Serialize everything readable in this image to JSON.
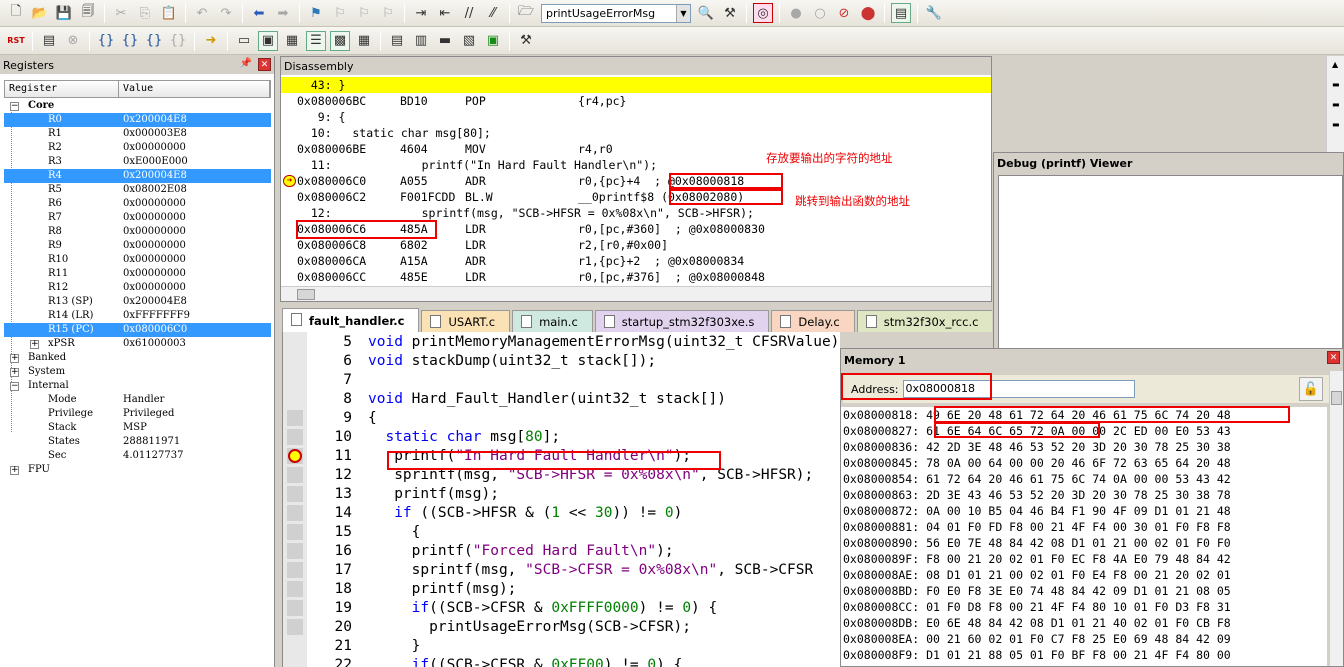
{
  "toolbar": {
    "function_combo": "printUsageErrorMsg"
  },
  "registers": {
    "title": "Registers",
    "col_register": "Register",
    "col_value": "Value",
    "core_label": "Core",
    "core": [
      {
        "name": "R0",
        "value": "0x200004E8",
        "selected": true
      },
      {
        "name": "R1",
        "value": "0x000003E8"
      },
      {
        "name": "R2",
        "value": "0x00000000"
      },
      {
        "name": "R3",
        "value": "0xE000E000"
      },
      {
        "name": "R4",
        "value": "0x200004E8",
        "selected": true
      },
      {
        "name": "R5",
        "value": "0x08002E08"
      },
      {
        "name": "R6",
        "value": "0x00000000"
      },
      {
        "name": "R7",
        "value": "0x00000000"
      },
      {
        "name": "R8",
        "value": "0x00000000"
      },
      {
        "name": "R9",
        "value": "0x00000000"
      },
      {
        "name": "R10",
        "value": "0x00000000"
      },
      {
        "name": "R11",
        "value": "0x00000000"
      },
      {
        "name": "R12",
        "value": "0x00000000"
      },
      {
        "name": "R13 (SP)",
        "value": "0x200004E8"
      },
      {
        "name": "R14 (LR)",
        "value": "0xFFFFFFF9"
      },
      {
        "name": "R15 (PC)",
        "value": "0x080006C0",
        "selected": true
      },
      {
        "name": "xPSR",
        "value": "0x61000003"
      }
    ],
    "groups": [
      "Banked",
      "System",
      "Internal"
    ],
    "internal": [
      {
        "name": "Mode",
        "value": "Handler"
      },
      {
        "name": "Privilege",
        "value": "Privileged"
      },
      {
        "name": "Stack",
        "value": "MSP"
      },
      {
        "name": "States",
        "value": "288811971"
      },
      {
        "name": "Sec",
        "value": "4.01127737"
      }
    ],
    "fpu_label": "FPU"
  },
  "disassembly": {
    "title": "Disassembly",
    "rows": [
      {
        "type": "src",
        "text": "  43: }",
        "highlight": true
      },
      {
        "type": "asm",
        "addr": "0x080006BC",
        "hex": "BD10",
        "mn": "POP",
        "op": "{r4,pc}"
      },
      {
        "type": "src",
        "text": "   9: {"
      },
      {
        "type": "src",
        "text": "  10:   static char msg[80];"
      },
      {
        "type": "asm",
        "addr": "0x080006BE",
        "hex": "4604",
        "mn": "MOV",
        "op": "r4,r0"
      },
      {
        "type": "src",
        "text": "  11:             printf(\"In Hard Fault Handler\\n\");"
      },
      {
        "type": "asm",
        "addr": "0x080006C0",
        "hex": "A055",
        "mn": "ADR",
        "op": "r0,{pc}+4  ; @0x08000818",
        "current": true
      },
      {
        "type": "asm",
        "addr": "0x080006C2",
        "hex": "F001FCDD",
        "mn": "BL.W",
        "op": "__0printf$8 (0x08002080)"
      },
      {
        "type": "src",
        "text": "  12:             sprintf(msg, \"SCB->HFSR = 0x%08x\\n\", SCB->HFSR);"
      },
      {
        "type": "asm",
        "addr": "0x080006C6",
        "hex": "485A",
        "mn": "LDR",
        "op": "r0,[pc,#360]  ; @0x08000830"
      },
      {
        "type": "asm",
        "addr": "0x080006C8",
        "hex": "6802",
        "mn": "LDR",
        "op": "r2,[r0,#0x00]"
      },
      {
        "type": "asm",
        "addr": "0x080006CA",
        "hex": "A15A",
        "mn": "ADR",
        "op": "r1,{pc}+2  ; @0x08000834"
      },
      {
        "type": "asm",
        "addr": "0x080006CC",
        "hex": "485E",
        "mn": "LDR",
        "op": "r0,[pc,#376]  ; @0x08000848"
      }
    ],
    "annotation_1": "存放要输出的字符的地址",
    "annotation_2": "跳转到输出函数的地址"
  },
  "tabs": [
    {
      "label": "fault_handler.c",
      "active": true,
      "color": "#ffffff"
    },
    {
      "label": "USART.c",
      "color": "#fbe2b5"
    },
    {
      "label": "main.c",
      "color": "#cfe8e0"
    },
    {
      "label": "startup_stm32f303xe.s",
      "color": "#e1d3ee"
    },
    {
      "label": "Delay.c",
      "color": "#f8d6c2"
    },
    {
      "label": "stm32f30x_rcc.c",
      "color": "#dfe6c4"
    },
    {
      "label": "syste",
      "color": "#f6e2b0"
    }
  ],
  "editor": {
    "lines": [
      {
        "n": "5",
        "code": "void printMemoryManagementErrorMsg(uint32_t CFSRValue);"
      },
      {
        "n": "6",
        "code": "void stackDump(uint32_t stack[]);"
      },
      {
        "n": "7",
        "code": ""
      },
      {
        "n": "8",
        "code": "void Hard_Fault_Handler(uint32_t stack[])"
      },
      {
        "n": "9",
        "code": "{"
      },
      {
        "n": "10",
        "code": "  static char msg[80];"
      },
      {
        "n": "11",
        "code": "   printf(\"In Hard Fault Handler\\n\");"
      },
      {
        "n": "12",
        "code": "   sprintf(msg, \"SCB->HFSR = 0x%08x\\n\", SCB->HFSR);"
      },
      {
        "n": "13",
        "code": "   printf(msg);"
      },
      {
        "n": "14",
        "code": "   if ((SCB->HFSR & (1 << 30)) != 0)"
      },
      {
        "n": "15",
        "code": "     {"
      },
      {
        "n": "16",
        "code": "     printf(\"Forced Hard Fault\\n\");"
      },
      {
        "n": "17",
        "code": "     sprintf(msg, \"SCB->CFSR = 0x%08x\\n\", SCB->CFSR"
      },
      {
        "n": "18",
        "code": "     printf(msg);"
      },
      {
        "n": "19",
        "code": "     if((SCB->CFSR & 0xFFFF0000) != 0) {"
      },
      {
        "n": "20",
        "code": "       printUsageErrorMsg(SCB->CFSR);"
      },
      {
        "n": "21",
        "code": "     }"
      },
      {
        "n": "22",
        "code": "     if((SCB->CFSR & 0xFF00) != 0) {"
      }
    ]
  },
  "printf_viewer": {
    "title": "Debug (printf) Viewer"
  },
  "memory": {
    "title": "Memory 1",
    "address_label": "Address:",
    "address_value": "0x08000818",
    "rows": [
      "0x08000818: 49 6E 20 48 61 72 64 20 46 61 75 6C 74 20 48",
      "0x08000827: 61 6E 64 6C 65 72 0A 00 00 2C ED 00 E0 53 43",
      "0x08000836: 42 2D 3E 48 46 53 52 20 3D 20 30 78 25 30 38",
      "0x08000845: 78 0A 00 64 00 00 20 46 6F 72 63 65 64 20 48",
      "0x08000854: 61 72 64 20 46 61 75 6C 74 0A 00 00 53 43 42",
      "0x08000863: 2D 3E 43 46 53 52 20 3D 20 30 78 25 30 38 78",
      "0x08000872: 0A 00 10 B5 04 46 B4 F1 90 4F 09 D1 01 21 48",
      "0x08000881: 04 01 F0 FD F8 00 21 4F F4 00 30 01 F0 F8 F8",
      "0x08000890: 56 E0 7E 48 84 42 08 D1 01 21 00 02 01 F0 F0",
      "0x0800089F: F8 00 21 20 02 01 F0 EC F8 4A E0 79 48 84 42",
      "0x080008AE: 08 D1 01 21 00 02 01 F0 E4 F8 00 21 20 02 01",
      "0x080008BD: F0 E0 F8 3E E0 74 48 84 42 09 D1 01 21 08 05",
      "0x080008CC: 01 F0 D8 F8 00 21 4F F4 80 10 01 F0 D3 F8 31",
      "0x080008DB: E0 6E 48 84 42 08 D1 01 21 40 02 01 F0 CB F8",
      "0x080008EA: 00 21 60 02 01 F0 C7 F8 25 E0 69 48 84 42 09",
      "0x080008F9: D1 01 21 88 05 01 F0 BF F8 00 21 4F F4 80 00"
    ]
  }
}
